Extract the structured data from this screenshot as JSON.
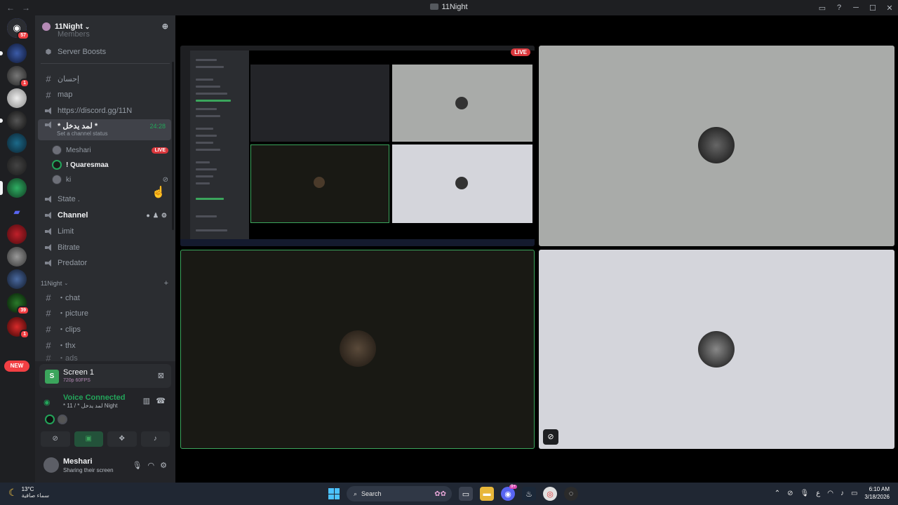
{
  "window": {
    "title": "11Night"
  },
  "guild": {
    "name": "11Night",
    "clipped_item": "Members",
    "boosts_label": "Server Boosts"
  },
  "channels": {
    "text1": "إحسان",
    "map": "map",
    "invite": "https://discord.gg/11N",
    "active_voice": {
      "name": "* لمد يدخل *",
      "time": "24:28",
      "status": "Set a channel status"
    },
    "voice_users": [
      {
        "name": "Meshari",
        "live": "LIVE"
      },
      {
        "name": "! Quaresmaa"
      },
      {
        "name": "ki"
      }
    ],
    "state": "State .",
    "channel": "Channel",
    "limit": "Limit",
    "bitrate": "Bitrate",
    "predator": "Predator",
    "category": "11Night",
    "text_channels": [
      "・chat",
      "・picture",
      "・clips",
      "・thx",
      "・ads"
    ]
  },
  "server_badges": {
    "home": "57",
    "s3": "1",
    "s12": "39",
    "s13": "1",
    "new": "NEW"
  },
  "panel": {
    "screen_title": "Screen 1",
    "screen_quality": "720p 60FPS",
    "voice_status": "Voice Connected",
    "voice_channel": "* 11 / * لمد يدخل Night",
    "user_name": "Meshari",
    "user_status": "Sharing their screen"
  },
  "stage": {
    "live_label": "LIVE"
  },
  "taskbar": {
    "temp": "13°C",
    "weather": "سماء صافية",
    "search": "Search",
    "discord_badge": "9+",
    "lang": "ع",
    "time": "6:10 AM",
    "date": "3/18/2026"
  },
  "colors": {
    "accent_green": "#23a55a",
    "live_red": "#da373c",
    "bg_dark": "#1e1f22",
    "sidebar": "#2b2d31"
  }
}
